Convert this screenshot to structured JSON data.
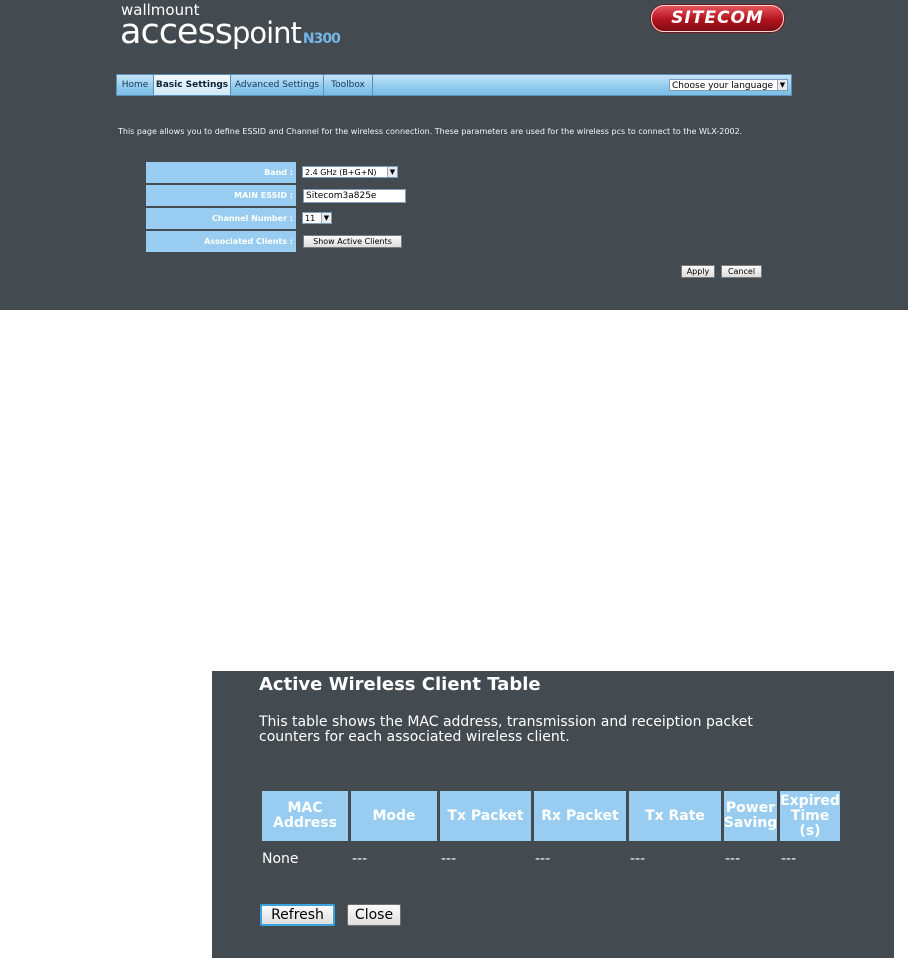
{
  "header": {
    "brand_small": "wallmount",
    "brand_word1": "access",
    "brand_word2": "point",
    "brand_model": "N300",
    "logo": "SITECOM"
  },
  "nav": {
    "tabs": [
      {
        "label": "Home"
      },
      {
        "label": "Basic Settings"
      },
      {
        "label": "Advanced Settings"
      },
      {
        "label": "Toolbox"
      }
    ],
    "active": "Basic Settings",
    "language_select": "Choose your language"
  },
  "description": "This page allows you to define ESSID and Channel for the wireless connection. These parameters are used for the wireless pcs to connect to the WLX-2002.",
  "form": {
    "band_label": "Band :",
    "band_value": "2.4 GHz (B+G+N)",
    "essid_label": "MAIN ESSID :",
    "essid_value": "Sitecom3a825e",
    "channel_label": "Channel Number :",
    "channel_value": "11",
    "clients_label": "Associated Clients :",
    "clients_button": "Show Active Clients",
    "apply": "Apply",
    "cancel": "Cancel"
  },
  "popup": {
    "title": "Active Wireless Client Table",
    "description": "This table shows the MAC address, transmission and receiption packet counters for each associated wireless client.",
    "columns": [
      "MAC Address",
      "Mode",
      "Tx Packet",
      "Rx Packet",
      "Tx Rate",
      "Power Saving",
      "Expired Time (s)"
    ],
    "rows": [
      [
        "None",
        "---",
        "---",
        "---",
        "---",
        "---",
        "---"
      ]
    ],
    "refresh": "Refresh",
    "close": "Close"
  },
  "colors": {
    "panel_bg": "#434a50",
    "label_bg": "#98cdf1",
    "nav_accent": "#8ecbee",
    "logo_red": "#b1141e"
  }
}
